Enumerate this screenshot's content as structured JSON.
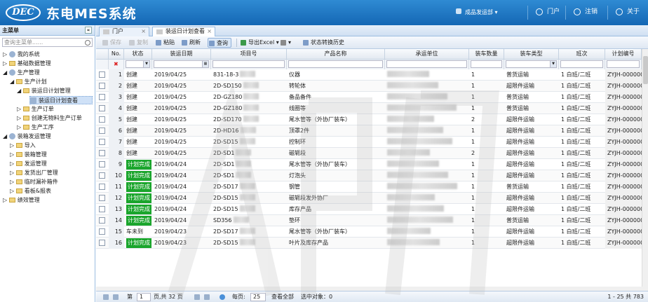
{
  "header": {
    "logo": "DEC",
    "title": "东电MES系统",
    "user": "成品发运部",
    "portal": "门户",
    "logout": "注销",
    "about": "关于"
  },
  "sidebar": {
    "title": "主菜单",
    "collapse": "«",
    "search_placeholder": "查询主菜单......",
    "items": [
      {
        "label": "我的系统"
      },
      {
        "label": "基础数据管理"
      },
      {
        "label": "生产管理"
      },
      {
        "label": "生产计划"
      },
      {
        "label": "装运日计划管理"
      },
      {
        "label": "装运日计划查看"
      },
      {
        "label": "生产订单"
      },
      {
        "label": "创建无物料生产订单"
      },
      {
        "label": "生产工序"
      },
      {
        "label": "装箱发运管理"
      },
      {
        "label": "导入"
      },
      {
        "label": "装箱管理"
      },
      {
        "label": "发运管理"
      },
      {
        "label": "发货出厂管理"
      },
      {
        "label": "临时漏补箱件"
      },
      {
        "label": "看板&报表"
      },
      {
        "label": "绩效管理"
      }
    ]
  },
  "tabs": [
    {
      "label": "门户",
      "close": "×"
    },
    {
      "label": "装运日计划查看",
      "close": "×"
    }
  ],
  "toolbar": {
    "save": "保存",
    "copy": "复制",
    "paste": "粘贴",
    "refresh": "刷新",
    "query": "查询",
    "export": "导出Excel",
    "filter": "▾",
    "history": "状态转换历史"
  },
  "columns": [
    "No.",
    "状态",
    "装运日期",
    "项目号",
    "产品名称",
    "承运单位",
    "装车数量",
    "装车类型",
    "班次",
    "计划编号"
  ],
  "rows": [
    {
      "no": "1",
      "status": "创建",
      "done": false,
      "date": "2019/04/25",
      "proj": "831-18-3",
      "product": "仪器",
      "qty": "1",
      "type": "普货运输",
      "shift": "1 白班/二班",
      "plan": "ZYJH-000000"
    },
    {
      "no": "2",
      "status": "创建",
      "done": false,
      "date": "2019/04/25",
      "proj": "2D-SD150",
      "product": "转轮体",
      "qty": "1",
      "type": "超限件运输",
      "shift": "1 白班/二班",
      "plan": "ZYJH-000000"
    },
    {
      "no": "3",
      "status": "创建",
      "done": false,
      "date": "2019/04/25",
      "proj": "2D-GZ180",
      "product": "备品备件",
      "qty": "1",
      "type": "普货运输",
      "shift": "1 白班/二班",
      "plan": "ZYJH-000000"
    },
    {
      "no": "4",
      "status": "创建",
      "done": false,
      "date": "2019/04/25",
      "proj": "2D-GZ180",
      "product": "线圈等",
      "qty": "1",
      "type": "普货运输",
      "shift": "1 白班/二班",
      "plan": "ZYJH-000000"
    },
    {
      "no": "5",
      "status": "创建",
      "done": false,
      "date": "2019/04/25",
      "proj": "2D-SD170",
      "product": "尾水管等（外协厂装车）",
      "qty": "2",
      "type": "超限件运输",
      "shift": "1 白班/二班",
      "plan": "ZYJH-000000"
    },
    {
      "no": "6",
      "status": "创建",
      "done": false,
      "date": "2019/04/25",
      "proj": "2D-HD16",
      "product": "顶罩2件",
      "qty": "1",
      "type": "超限件运输",
      "shift": "1 白班/二班",
      "plan": "ZYJH-000000"
    },
    {
      "no": "7",
      "status": "创建",
      "done": false,
      "date": "2019/04/25",
      "proj": "2D-SD15",
      "product": "控制环",
      "qty": "1",
      "type": "超限件运输",
      "shift": "1 白班/二班",
      "plan": "ZYJH-000000"
    },
    {
      "no": "8",
      "status": "创建",
      "done": false,
      "date": "2019/04/25",
      "proj": "2D-SD1",
      "product": "磁轭段",
      "qty": "2",
      "type": "超限件运输",
      "shift": "1 白班/二班",
      "plan": "ZYJH-000000"
    },
    {
      "no": "9",
      "status": "计划完成",
      "done": true,
      "date": "2019/04/24",
      "proj": "2D-SD1",
      "product": "尾水管等（外协厂装车）",
      "qty": "1",
      "type": "超限件运输",
      "shift": "1 白班/二班",
      "plan": "ZYJH-000000"
    },
    {
      "no": "10",
      "status": "计划完成",
      "done": true,
      "date": "2019/04/24",
      "proj": "2D-SD1",
      "product": "灯泡头",
      "qty": "1",
      "type": "超限件运输",
      "shift": "1 白班/二班",
      "plan": "ZYJH-000000"
    },
    {
      "no": "11",
      "status": "计划完成",
      "done": true,
      "date": "2019/04/24",
      "proj": "2D-SD17",
      "product": "钢管",
      "qty": "1",
      "type": "普货运输",
      "shift": "1 白班/二班",
      "plan": "ZYJH-000000"
    },
    {
      "no": "12",
      "status": "计划完成",
      "done": true,
      "date": "2019/04/24",
      "proj": "2D-SD15",
      "product": "磁轭段发外协厂",
      "qty": "1",
      "type": "超限件运输",
      "shift": "1 白班/二班",
      "plan": "ZYJH-000000"
    },
    {
      "no": "13",
      "status": "计划完成",
      "done": true,
      "date": "2019/04/24",
      "proj": "2D-SD15",
      "product": "库存产品",
      "qty": "1",
      "type": "超限件运输",
      "shift": "1 白班/二班",
      "plan": "ZYJH-000000"
    },
    {
      "no": "14",
      "status": "计划完成",
      "done": true,
      "date": "2019/04/24",
      "proj": "SD356",
      "product": "垫环",
      "qty": "1",
      "type": "普货运输",
      "shift": "1 白班/二班",
      "plan": "ZYJH-000000"
    },
    {
      "no": "15",
      "status": "车未到",
      "done": false,
      "date": "2019/04/23",
      "proj": "2D-SD17",
      "product": "尾水管等（外协厂装车）",
      "qty": "1",
      "type": "超限件运输",
      "shift": "1 白班/二班",
      "plan": "ZYJH-000000"
    },
    {
      "no": "16",
      "status": "计划完成",
      "done": true,
      "date": "2019/04/23",
      "proj": "2D-SD15",
      "product": "叶片及库存产品",
      "qty": "1",
      "type": "超限件运输",
      "shift": "1 白班/二班",
      "plan": "ZYJH-000000"
    }
  ],
  "pager": {
    "page_label": "第",
    "page_value": "1",
    "of_pages": "页,共 32 页",
    "per_page_label": "每页:",
    "per_page_value": "25",
    "view_all": "查看全部",
    "selected": "选中对象：0",
    "summary": "1 - 25 共 783"
  },
  "colors": {
    "header": "#1f77c4",
    "done_badge": "#1aa52c"
  }
}
